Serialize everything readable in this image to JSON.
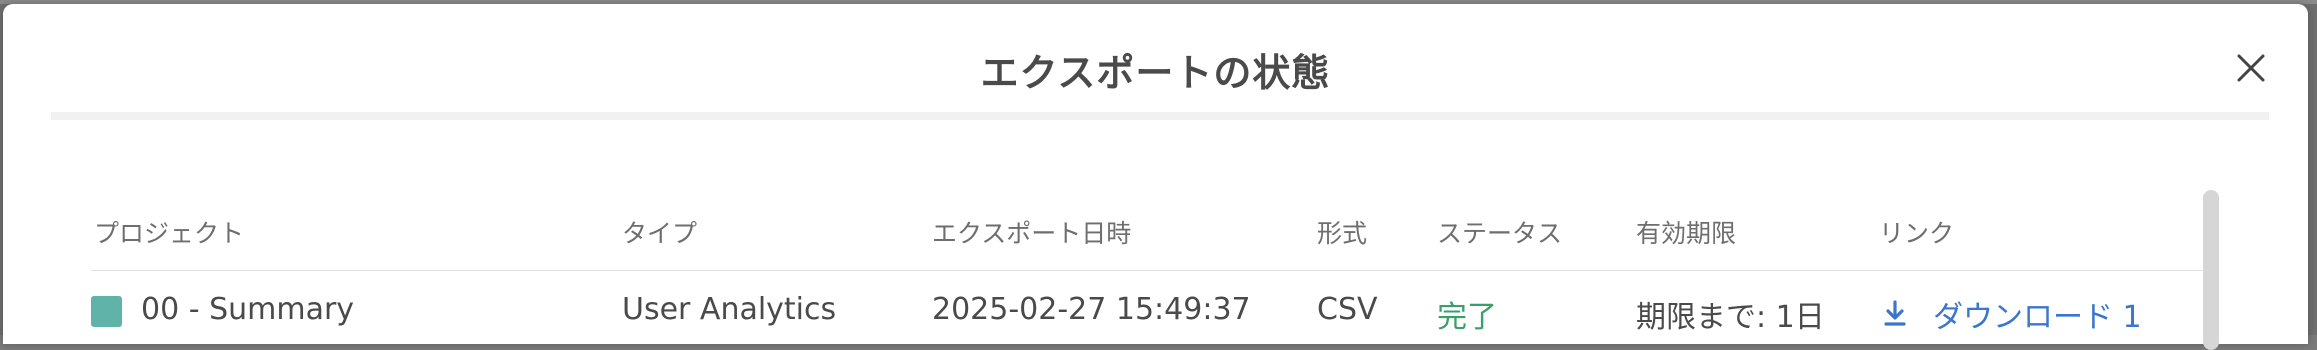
{
  "modal": {
    "title": "エクスポートの状態"
  },
  "table": {
    "headers": {
      "project": "プロジェクト",
      "type": "タイプ",
      "export_datetime": "エクスポート日時",
      "format": "形式",
      "status": "ステータス",
      "expiry": "有効期限",
      "link": "リンク"
    },
    "rows": [
      {
        "project": "00 - Summary",
        "project_color": "#5fb3a8",
        "type": "User Analytics",
        "export_datetime": "2025-02-27 15:49:37",
        "format": "CSV",
        "status": "完了",
        "expiry": "期限まで: 1日",
        "link": "ダウンロード 1"
      }
    ]
  },
  "icons": {
    "close": "close-icon",
    "download": "download-icon"
  },
  "colors": {
    "status_complete": "#3aa06a",
    "link": "#3a76cc"
  }
}
